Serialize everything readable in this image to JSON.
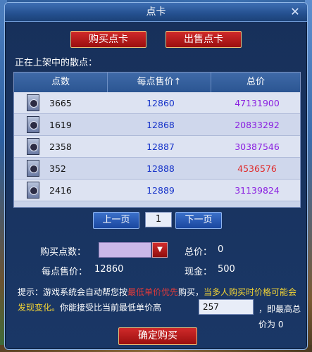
{
  "window": {
    "title": "点卡",
    "close_glyph": "✕"
  },
  "tabs": {
    "buy": "购买点卡",
    "sell": "出售点卡"
  },
  "list_label": "正在上架中的散点：",
  "table": {
    "headers": {
      "points": "点数",
      "unit_price": "每点售价↑",
      "total": "总价"
    },
    "rows": [
      {
        "points": "3665",
        "unit_price": "12860",
        "total": "47131900",
        "total_color": "#8a1fe0"
      },
      {
        "points": "1619",
        "unit_price": "12868",
        "total": "20833292",
        "total_color": "#8a1fe0"
      },
      {
        "points": "2358",
        "unit_price": "12887",
        "total": "30387546",
        "total_color": "#8a1fe0"
      },
      {
        "points": "352",
        "unit_price": "12888",
        "total": "4536576",
        "total_color": "#e02a2a"
      },
      {
        "points": "2416",
        "unit_price": "12889",
        "total": "31139824",
        "total_color": "#8a1fe0"
      }
    ]
  },
  "pager": {
    "prev": "上一页",
    "page": "1",
    "next": "下一页"
  },
  "form": {
    "buy_points_label": "购买点数：",
    "buy_points_value": "",
    "total_price_label": "总价：",
    "total_price_value": "0",
    "unit_price_label": "每点售价：",
    "unit_price_value": "12860",
    "cash_label": "现金：",
    "cash_value": "500"
  },
  "tip": {
    "prefix": "提示：游戏系统会自动帮您按",
    "red_part": "最低单价优先",
    "middle": "购买，",
    "yellow_part": "当多人购买时价格可能会发现变化。",
    "accept_text": "你能接受比当前最低单价高",
    "price_diff_value": "257",
    "suffix": "，即最高总价为 0"
  },
  "confirm_button": "确定购买",
  "colors": {
    "accent_red": "#b31717",
    "price_blue": "#1633c9",
    "total_purple": "#8a1fe0",
    "total_red": "#e02a2a"
  }
}
